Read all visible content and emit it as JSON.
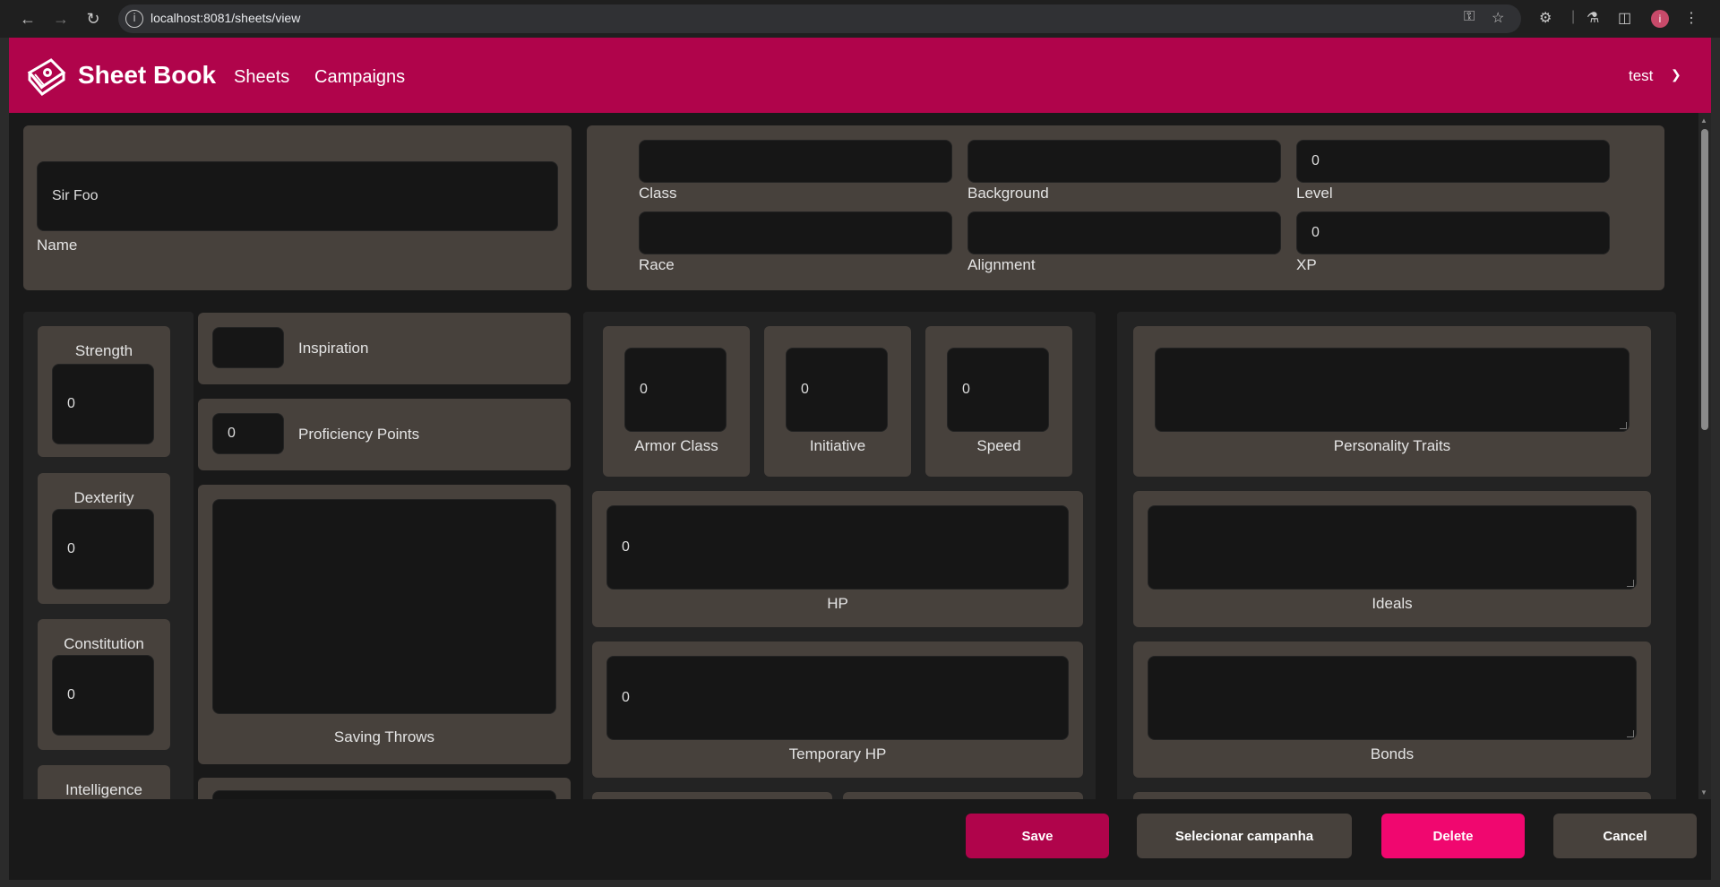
{
  "browser": {
    "url": "localhost:8081/sheets/view",
    "profile_initial": "i"
  },
  "app": {
    "brand": "Sheet Book",
    "nav": {
      "sheets": "Sheets",
      "campaigns": "Campaigns"
    },
    "user": "test",
    "brand_color": "#b0044b"
  },
  "sheet": {
    "name": {
      "value": "Sir Foo",
      "label": "Name"
    },
    "class": {
      "value": "",
      "label": "Class"
    },
    "background": {
      "value": "",
      "label": "Background"
    },
    "level": {
      "value": "0",
      "label": "Level"
    },
    "race": {
      "value": "",
      "label": "Race"
    },
    "alignment": {
      "value": "",
      "label": "Alignment"
    },
    "xp": {
      "value": "0",
      "label": "XP"
    },
    "abilities": [
      {
        "label": "Strength",
        "value": "0"
      },
      {
        "label": "Dexterity",
        "value": "0"
      },
      {
        "label": "Constitution",
        "value": "0"
      },
      {
        "label": "Intelligence",
        "value": ""
      }
    ],
    "inspiration": {
      "value": "",
      "label": "Inspiration"
    },
    "proficiency": {
      "value": "0",
      "label": "Proficiency Points"
    },
    "saving_throws": {
      "label": "Saving Throws"
    },
    "armor_class": {
      "value": "0",
      "label": "Armor Class"
    },
    "initiative": {
      "value": "0",
      "label": "Initiative"
    },
    "speed": {
      "value": "0",
      "label": "Speed"
    },
    "hp": {
      "value": "0",
      "label": "HP"
    },
    "temp_hp": {
      "value": "0",
      "label": "Temporary HP"
    },
    "personality": {
      "label": "Personality Traits"
    },
    "ideals": {
      "label": "Ideals"
    },
    "bonds": {
      "label": "Bonds"
    }
  },
  "footer": {
    "save": "Save",
    "select_campaign": "Selecionar campanha",
    "delete": "Delete",
    "cancel": "Cancel",
    "save_color": "#b0044b",
    "delete_color": "#f0076f",
    "neutral_color": "#47413c"
  }
}
